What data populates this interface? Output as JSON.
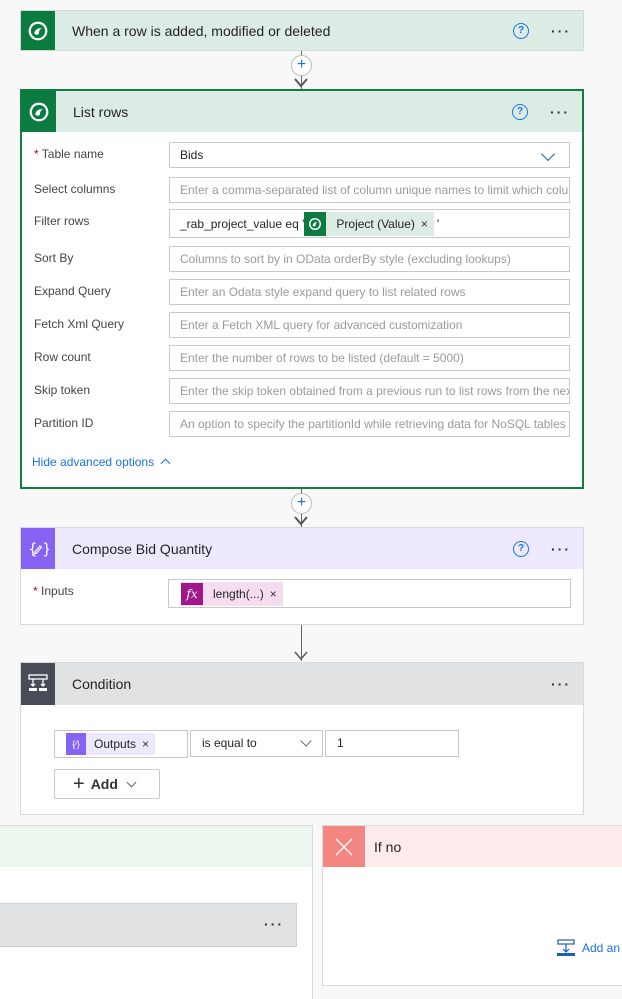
{
  "trigger": {
    "title": "When a row is added, modified or deleted",
    "icon": "dataverse-icon"
  },
  "list_rows": {
    "title": "List rows",
    "icon": "dataverse-icon",
    "fields": [
      {
        "label": "Table name",
        "required": true,
        "value": "Bids",
        "type": "dropdown"
      },
      {
        "label": "Select columns",
        "placeholder": "Enter a comma-separated list of column unique names to limit which columns"
      },
      {
        "label": "Filter rows",
        "prefix": "_rab_project_value eq '",
        "token": "Project (Value)",
        "suffix": "'"
      },
      {
        "label": "Sort By",
        "placeholder": "Columns to sort by in OData orderBy style (excluding lookups)"
      },
      {
        "label": "Expand Query",
        "placeholder": "Enter an Odata style expand query to list related rows"
      },
      {
        "label": "Fetch Xml Query",
        "placeholder": "Enter a Fetch XML query for advanced customization"
      },
      {
        "label": "Row count",
        "placeholder": "Enter the number of rows to be listed (default = 5000)"
      },
      {
        "label": "Skip token",
        "placeholder": "Enter the skip token obtained from a previous run to list rows from the next pa"
      },
      {
        "label": "Partition ID",
        "placeholder": "An option to specify the partitionId while retrieving data for NoSQL tables"
      }
    ],
    "hide_advanced": "Hide advanced options"
  },
  "compose": {
    "title": "Compose Bid Quantity",
    "icon": "compose-icon",
    "inputs_label": "Inputs",
    "inputs_token": "length(...)"
  },
  "condition": {
    "title": "Condition",
    "left_token": "Outputs",
    "operator": "is equal to",
    "right_value": "1",
    "add_label": "Add"
  },
  "branches": {
    "no_title": "If no",
    "add_action": "Add an action"
  },
  "colors": {
    "dataverse_green": "#0b7b40",
    "compose_purple": "#8763f3",
    "condition_dark": "#474c56",
    "no_red": "#f48682",
    "link_blue": "#1a73e8"
  }
}
